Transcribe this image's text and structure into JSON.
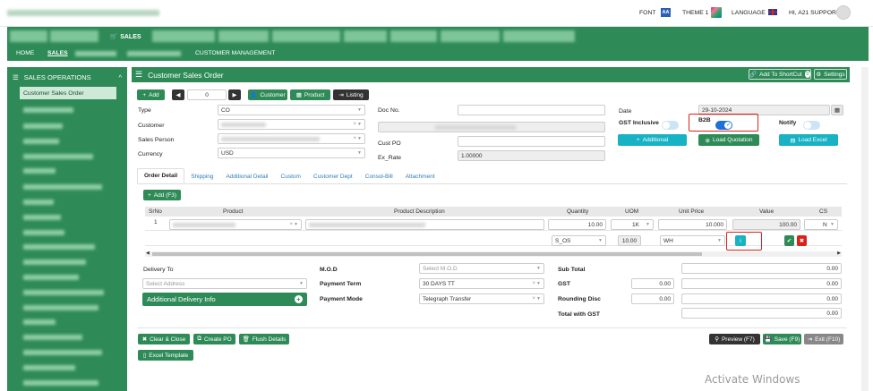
{
  "topbar": {
    "font_label": "FONT",
    "font_icon": "AA",
    "theme_label": "THEME 1",
    "language_label": "LANGUAGE",
    "user_label": "HI, A21 SUPPORT"
  },
  "nav": {
    "sales_tab": "SALES",
    "sub_items": [
      "HOME",
      "SALES",
      "CUSTOMER MANAGEMENT"
    ]
  },
  "sidebar": {
    "title": "SALES OPERATIONS",
    "active_item": "Customer Sales Order"
  },
  "page": {
    "title": "Customer Sales Order",
    "add_shortcut": "Add To ShortCut",
    "settings": "Settings"
  },
  "toolbar": {
    "add": "Add",
    "counter": "0",
    "customer": "Customer",
    "product": "Product",
    "listing": "Listing"
  },
  "form": {
    "type_label": "Type",
    "type_value": "CO",
    "customer_label": "Customer",
    "sales_person_label": "Sales Person",
    "currency_label": "Currency",
    "currency_value": "USD",
    "doc_no_label": "Doc No.",
    "cust_po_label": "Cust PO",
    "ex_rate_label": "Ex_Rate",
    "ex_rate_value": "1.00000",
    "date_label": "Date",
    "date_value": "29-10-2024",
    "gst_inclusive_label": "GST Inclusive",
    "b2b_label": "B2B",
    "notify_label": "Notify",
    "additional_btn": "Additional",
    "load_quotation_btn": "Load Quotation",
    "load_excel_btn": "Load Excel"
  },
  "tabs": [
    "Order Detail",
    "Shipping",
    "Additional Detail",
    "Custom",
    "Customer Dept",
    "Consol-Bill",
    "Attachment"
  ],
  "grid": {
    "add_btn": "Add (F3)",
    "headers": [
      "SrNo",
      "Product",
      "Product Description",
      "Quantity",
      "UOM",
      "Unit Price",
      "Value",
      "CS"
    ],
    "row1": {
      "srno": "1",
      "quantity": "10.00",
      "uom": "1K",
      "unit_price": "10.000",
      "value": "100.00",
      "cs": "N"
    },
    "row2": {
      "location": "S_OS",
      "qty2": "10.00",
      "warehouse": "WH"
    }
  },
  "bottom": {
    "delivery_to_label": "Delivery To",
    "select_address_ph": "Select Address",
    "additional_delivery_info": "Additional Delivery Info",
    "mod_label": "M.O.D",
    "mod_ph": "Select M.O.D",
    "payment_term_label": "Payment Term",
    "payment_term_value": "30 DAYS TT",
    "payment_mode_label": "Payment Mode",
    "payment_mode_value": "Telegraph Transfer",
    "sub_total_label": "Sub Total",
    "sub_total_value": "0.00",
    "gst_label": "GST",
    "gst_rate": "0.00",
    "gst_value": "0.00",
    "rounding_label": "Rounding Disc",
    "rounding_rate": "0.00",
    "rounding_value": "0.00",
    "total_label": "Total with GST",
    "total_value": "0.00"
  },
  "actions": {
    "clear_close": "Clear & Close",
    "create_po": "Create PO",
    "flush_details": "Flush Details",
    "excel_template": "Excel Template",
    "preview": "Preview (F7)",
    "save": "Save (F9)",
    "exit": "Exit (F10)"
  },
  "watermark": "Activate Windows",
  "colors": {
    "primary_green": "#2e8b57",
    "teal": "#17b2c3",
    "highlight_red": "#d9231a",
    "toggle_blue": "#1e6fd9"
  }
}
